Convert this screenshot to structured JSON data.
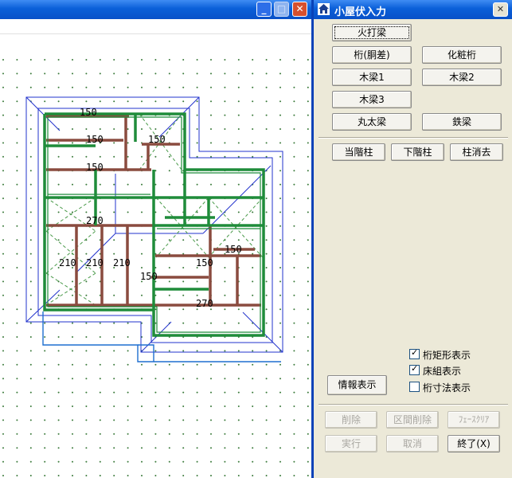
{
  "window": {
    "minimize_glyph": "_",
    "maximize_glyph": "□",
    "close_glyph": "✕"
  },
  "plan": {
    "labels": [
      "150",
      "150",
      "150",
      "150",
      "270",
      "210",
      "210",
      "210",
      "150",
      "150",
      "150",
      "270"
    ]
  },
  "panel": {
    "title": "小屋伏入力",
    "close_glyph": "✕",
    "buttons": {
      "hiuchi": "火打梁",
      "keta": "桁(胴差)",
      "kesho": "化粧桁",
      "mokuryo1": "木梁1",
      "mokuryo2": "木梁2",
      "mokuryo3": "木梁3",
      "marutaryo": "丸太梁",
      "tekkoryo": "鉄梁"
    },
    "column_buttons": {
      "current": "当階柱",
      "lower": "下階柱",
      "erase": "柱消去"
    },
    "info_button": "情報表示",
    "checks": [
      {
        "label": "桁矩形表示",
        "checked": true
      },
      {
        "label": "床組表示",
        "checked": true
      },
      {
        "label": "桁寸法表示",
        "checked": false
      }
    ],
    "bottom": {
      "delete": "削除",
      "range_delete": "区間削除",
      "face_clear": "ﾌｪｰｽｸﾘｱ",
      "execute": "実行",
      "cancel": "取消",
      "finish": "終了(X)"
    }
  }
}
